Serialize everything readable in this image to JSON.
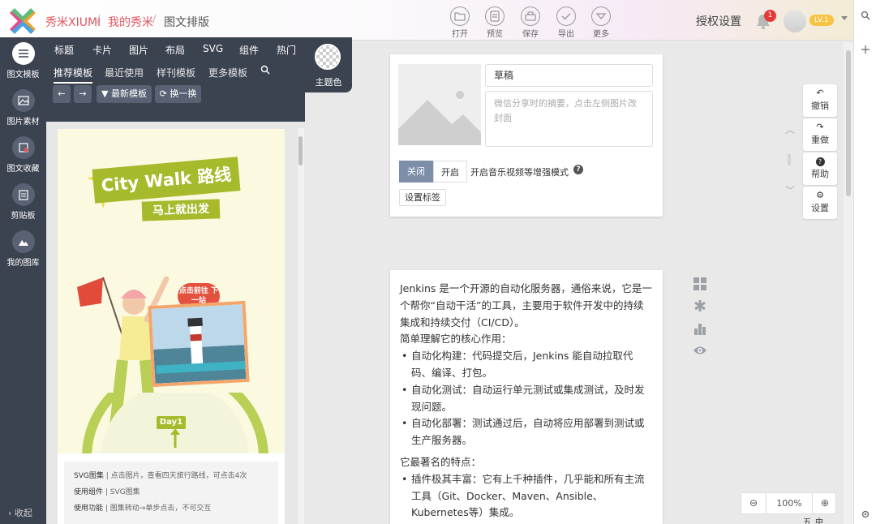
{
  "header": {
    "brand": "秀米XIUMI",
    "crumb_mine": "我的秀米",
    "crumb_page": "图文排版",
    "sep": "/",
    "tools": [
      {
        "label": "打开",
        "icon": "folder-icon"
      },
      {
        "label": "预览",
        "icon": "preview-icon"
      },
      {
        "label": "保存",
        "icon": "save-icon"
      },
      {
        "label": "导出",
        "icon": "check-export-icon"
      },
      {
        "label": "更多",
        "icon": "chevron-down-icon"
      }
    ],
    "auth": "授权设置",
    "notif_count": "1",
    "level": "LV.1"
  },
  "left_nav": {
    "items": [
      "图文模板",
      "图片素材",
      "图文收藏",
      "剪贴板",
      "我的图库"
    ],
    "collapse": "收起"
  },
  "panel": {
    "tabs_row1": [
      "标题",
      "卡片",
      "图片",
      "布局",
      "SVG",
      "组件",
      "热门"
    ],
    "tabs_row2": [
      "推荐模板",
      "最近使用",
      "样刊模板",
      "更多模板"
    ],
    "theme_label": "主题色",
    "btn_new": "最新模板",
    "btn_swap": "换一换",
    "poster": {
      "title": "City Walk 路线",
      "subtitle": "马上就出发",
      "badge": "点击前往 下一站",
      "day": "Day1"
    },
    "card_desc": [
      {
        "k": "SVG图集",
        "v": "点击图片，查看四天旅行路线，可点击4次"
      },
      {
        "k": "使用组件",
        "v": "SVG图集"
      },
      {
        "k": "使用功能",
        "v": "图集转动→单步点击，不可交互"
      }
    ]
  },
  "editor": {
    "title_value": "草稿",
    "summary_placeholder": "微信分享时的摘要，点击左侧图片改封面",
    "toggle_off": "关闭",
    "toggle_on": "开启",
    "music_label": "开启音乐视频等增强模式",
    "tag_btn": "设置标签",
    "body": {
      "p1": "Jenkins 是一个开源的自动化服务器，通俗来说，它是一个帮你“自动干活”的工具，主要用于软件开发中的持续集成和持续交付（CI/CD）。",
      "p2": "简单理解它的核心作用：",
      "list1": [
        "自动化构建：代码提交后，Jenkins 能自动拉取代码、编译、打包。",
        "自动化测试：自动运行单元测试或集成测试，及时发现问题。",
        "自动化部署：测试通过后，自动将应用部署到测试或生产服务器。"
      ],
      "p3": "它最著名的特点：",
      "list2": [
        "插件极其丰富：它有上千种插件，几乎能和所有主流工具（Git、Docker、Maven、Ansible、Kubernetes等）集成。"
      ]
    }
  },
  "right_tools": [
    {
      "label": "撤销",
      "icon": "undo-icon"
    },
    {
      "label": "重做",
      "icon": "redo-icon"
    },
    {
      "label": "帮助",
      "icon": "help-icon"
    },
    {
      "label": "设置",
      "icon": "gear-icon"
    }
  ],
  "zoom": {
    "value": "100%"
  },
  "ime": [
    "五",
    "中"
  ],
  "colors": {
    "accent_green": "#a7ba2c",
    "sidebar": "#3b4250",
    "brand_red": "#e0565e"
  }
}
